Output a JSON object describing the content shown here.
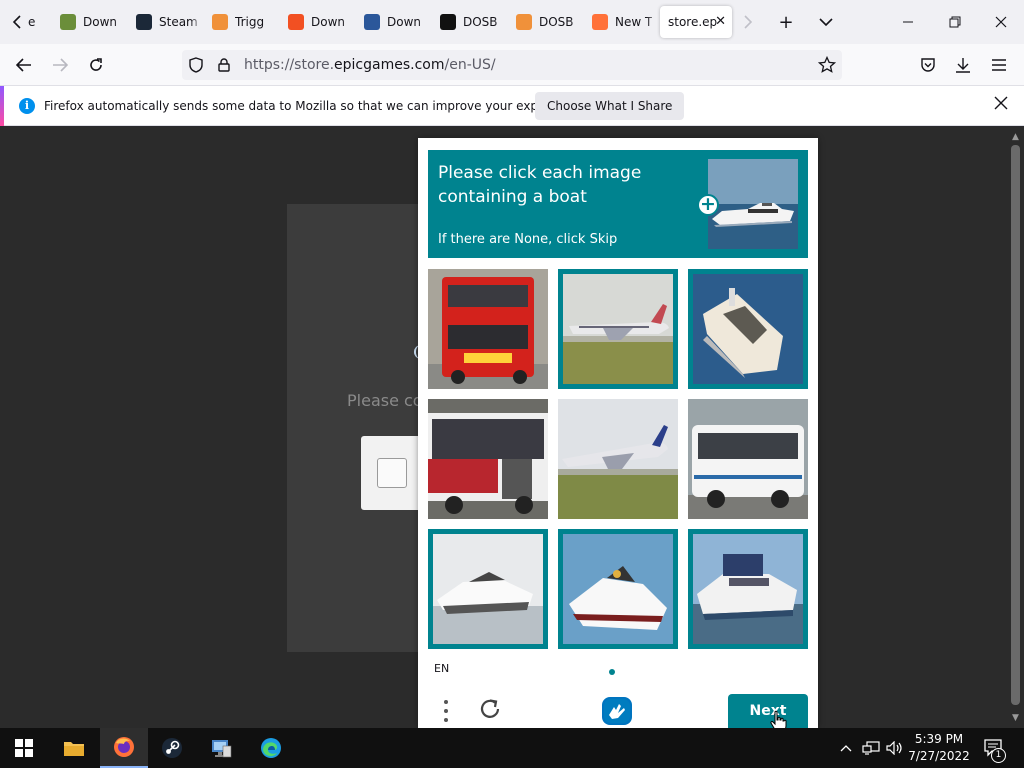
{
  "browser": {
    "tabs": [
      {
        "title": "Down",
        "icon": "minecraft-icon",
        "color": "#6b8e3a"
      },
      {
        "title": "Steam",
        "icon": "steam-icon",
        "color": "#1b2838"
      },
      {
        "title": "Trigg",
        "icon": "diamond-icon",
        "color": "#f0913a"
      },
      {
        "title": "Down",
        "icon": "windows-store-icon",
        "color": "#f25022"
      },
      {
        "title": "Down",
        "icon": "chart-icon",
        "color": "#2b579a"
      },
      {
        "title": "DOSB",
        "icon": "dosbox-icon",
        "color": "#111111"
      },
      {
        "title": "DOSB",
        "icon": "diamond-icon",
        "color": "#f0913a"
      },
      {
        "title": "New T",
        "icon": "firefox-icon",
        "color": "#ff7139"
      }
    ],
    "first_tab_partial": "e",
    "active_tab": {
      "title": "store.ep",
      "close": "✕"
    },
    "new_tab": "+",
    "list_tabs": "⌵",
    "url": {
      "prefix": "https://store.",
      "domain": "epicgames.com",
      "path": "/en-US/"
    }
  },
  "notification": {
    "message": "Firefox automatically sends some data to Mozilla so that we can improve your experience.",
    "button": "Choose What I Share"
  },
  "background": {
    "partial_text": "Please co"
  },
  "captcha": {
    "prompt": "Please click each image containing a boat",
    "hint": "If there are None, click Skip",
    "language": "EN",
    "next_label": "Next",
    "tiles": [
      {
        "subject": "red-double-decker-bus",
        "selected": false
      },
      {
        "subject": "airplane-on-runway",
        "selected": true
      },
      {
        "subject": "white-yacht",
        "selected": true
      },
      {
        "subject": "red-white-bus",
        "selected": false
      },
      {
        "subject": "airplane-taking-off",
        "selected": false
      },
      {
        "subject": "white-coach-bus",
        "selected": false
      },
      {
        "subject": "speedboat",
        "selected": true
      },
      {
        "subject": "speedboat-red-stripe",
        "selected": true
      },
      {
        "subject": "cabin-cruiser-boat",
        "selected": true
      }
    ]
  },
  "taskbar": {
    "time": "5:39 PM",
    "date": "7/27/2022",
    "notification_count": "1"
  },
  "colors": {
    "captcha_accent": "#00838f",
    "page_bg": "#2b2b2b"
  }
}
